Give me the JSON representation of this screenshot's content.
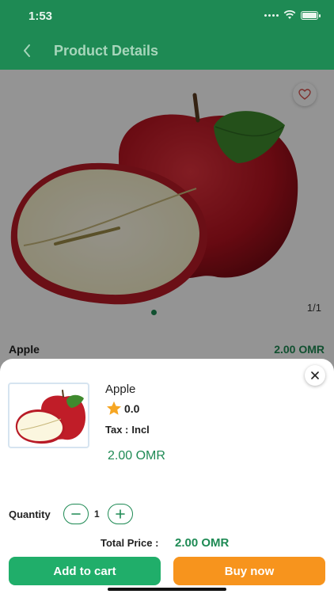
{
  "status_bar": {
    "time": "1:53"
  },
  "nav": {
    "title": "Product Details"
  },
  "gallery": {
    "pager": "1/1"
  },
  "product": {
    "name": "Apple",
    "price": "2.00 OMR"
  },
  "sheet": {
    "name": "Apple",
    "rating": "0.0",
    "tax_label": "Tax :",
    "tax_value": "Incl",
    "price": "2.00 OMR",
    "quantity_label": "Quantity",
    "quantity_value": "1",
    "total_label": "Total Price :",
    "total_value": "2.00 OMR",
    "add_to_cart": "Add to cart",
    "buy_now": "Buy now"
  },
  "icons": {
    "back": "chevron-left-icon",
    "wishlist": "heart-outline-icon",
    "close": "close-icon",
    "star": "star-icon",
    "minus": "minus-icon",
    "plus": "plus-icon"
  },
  "colors": {
    "primary": "#1e8a54",
    "add_to_cart": "#20ae6a",
    "buy_now": "#f7941d",
    "star": "#f6a623"
  }
}
